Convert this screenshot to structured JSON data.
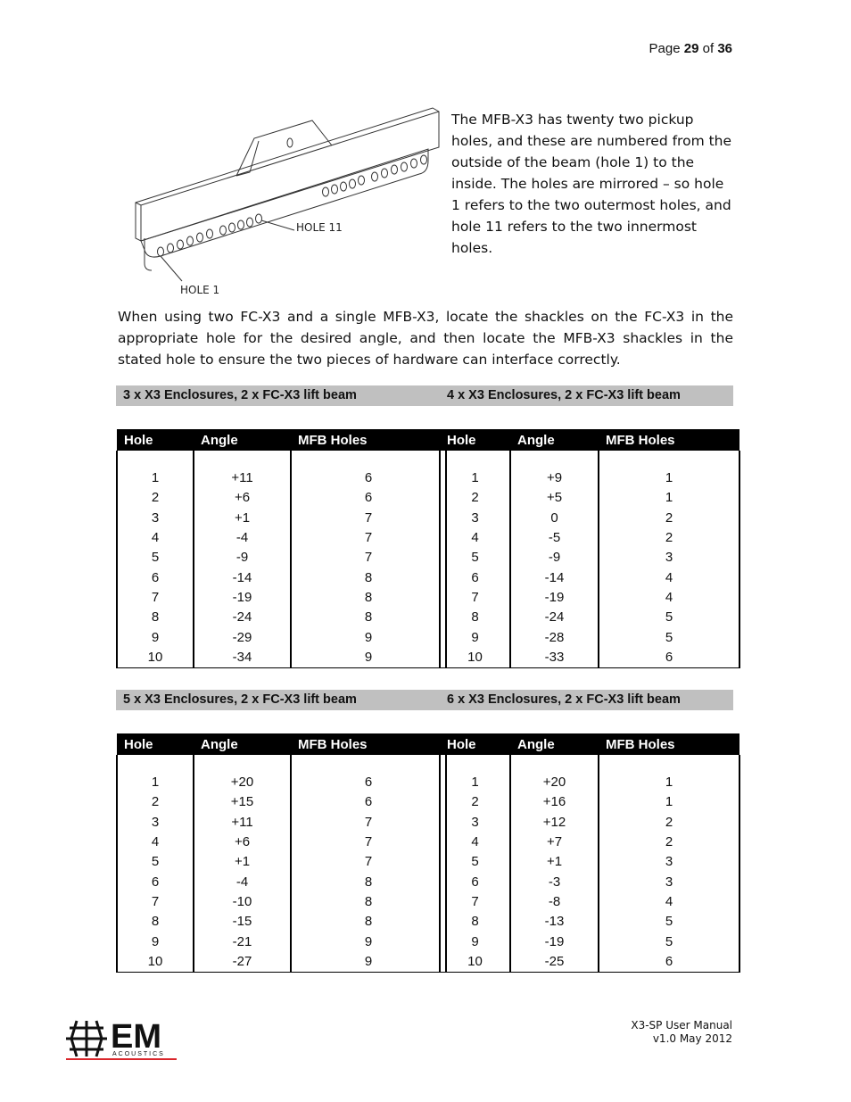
{
  "header": {
    "page_prefix": "Page",
    "page_current": "29",
    "page_of": "of",
    "page_total": "36"
  },
  "figure": {
    "label_hole_11": "HOLE 11",
    "label_hole_1": "HOLE 1"
  },
  "intro_text": "The MFB-X3 has twenty two pickup holes, and these are numbered from the outside of the beam (hole 1) to the inside.  The holes are mirrored – so hole 1 refers to the two outermost holes, and hole 11 refers to the two innermost holes.",
  "paragraph": "When using two FC-X3 and a single MFB-X3, locate the shackles on the FC-X3 in the appropriate hole for the desired angle, and then locate the MFB-X3 shackles in the stated hole to ensure the two pieces of hardware can interface correctly.",
  "columns": [
    "Hole",
    "Angle",
    "MFB Holes"
  ],
  "tables": [
    {
      "title": "3 x X3 Enclosures, 2 x FC-X3 lift beam",
      "rows": [
        [
          "1",
          "+11",
          "6"
        ],
        [
          "2",
          "+6",
          "6"
        ],
        [
          "3",
          "+1",
          "7"
        ],
        [
          "4",
          "-4",
          "7"
        ],
        [
          "5",
          "-9",
          "7"
        ],
        [
          "6",
          "-14",
          "8"
        ],
        [
          "7",
          "-19",
          "8"
        ],
        [
          "8",
          "-24",
          "8"
        ],
        [
          "9",
          "-29",
          "9"
        ],
        [
          "10",
          "-34",
          "9"
        ]
      ]
    },
    {
      "title": "4 x X3 Enclosures, 2 x FC-X3 lift beam",
      "rows": [
        [
          "1",
          "+9",
          "1"
        ],
        [
          "2",
          "+5",
          "1"
        ],
        [
          "3",
          "0",
          "2"
        ],
        [
          "4",
          "-5",
          "2"
        ],
        [
          "5",
          "-9",
          "3"
        ],
        [
          "6",
          "-14",
          "4"
        ],
        [
          "7",
          "-19",
          "4"
        ],
        [
          "8",
          "-24",
          "5"
        ],
        [
          "9",
          "-28",
          "5"
        ],
        [
          "10",
          "-33",
          "6"
        ]
      ]
    },
    {
      "title": "5 x X3 Enclosures, 2 x FC-X3 lift beam",
      "rows": [
        [
          "1",
          "+20",
          "6"
        ],
        [
          "2",
          "+15",
          "6"
        ],
        [
          "3",
          "+11",
          "7"
        ],
        [
          "4",
          "+6",
          "7"
        ],
        [
          "5",
          "+1",
          "7"
        ],
        [
          "6",
          "-4",
          "8"
        ],
        [
          "7",
          "-10",
          "8"
        ],
        [
          "8",
          "-15",
          "8"
        ],
        [
          "9",
          "-21",
          "9"
        ],
        [
          "10",
          "-27",
          "9"
        ]
      ]
    },
    {
      "title": "6 x X3 Enclosures, 2 x FC-X3 lift beam",
      "rows": [
        [
          "1",
          "+20",
          "1"
        ],
        [
          "2",
          "+16",
          "1"
        ],
        [
          "3",
          "+12",
          "2"
        ],
        [
          "4",
          "+7",
          "2"
        ],
        [
          "5",
          "+1",
          "3"
        ],
        [
          "6",
          "-3",
          "3"
        ],
        [
          "7",
          "-8",
          "4"
        ],
        [
          "8",
          "-13",
          "5"
        ],
        [
          "9",
          "-19",
          "5"
        ],
        [
          "10",
          "-25",
          "6"
        ]
      ]
    }
  ],
  "footer": {
    "manual": "X3-SP User Manual",
    "version": "v1.0 May 2012",
    "logo_main": "EM",
    "logo_sub": "ACOUSTICS",
    "logo_accent": "#d9262b"
  }
}
